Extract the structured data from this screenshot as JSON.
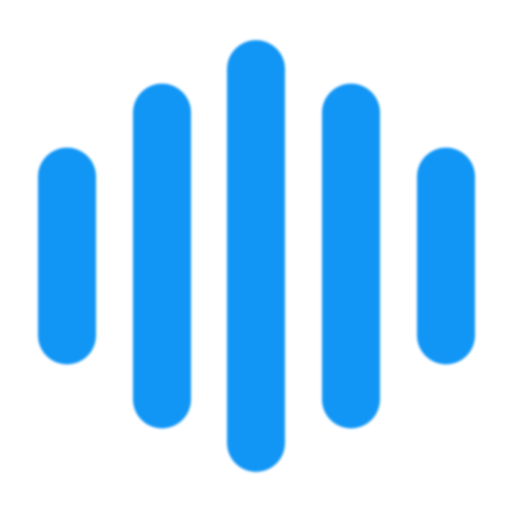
{
  "icon": {
    "name": "sound-wave-icon",
    "color": "#1196f5",
    "background": "#ffffff",
    "bars": [
      {
        "level": 0.31
      },
      {
        "level": 0.56
      },
      {
        "level": 0.73
      },
      {
        "level": 0.56
      },
      {
        "level": 0.31
      }
    ]
  }
}
